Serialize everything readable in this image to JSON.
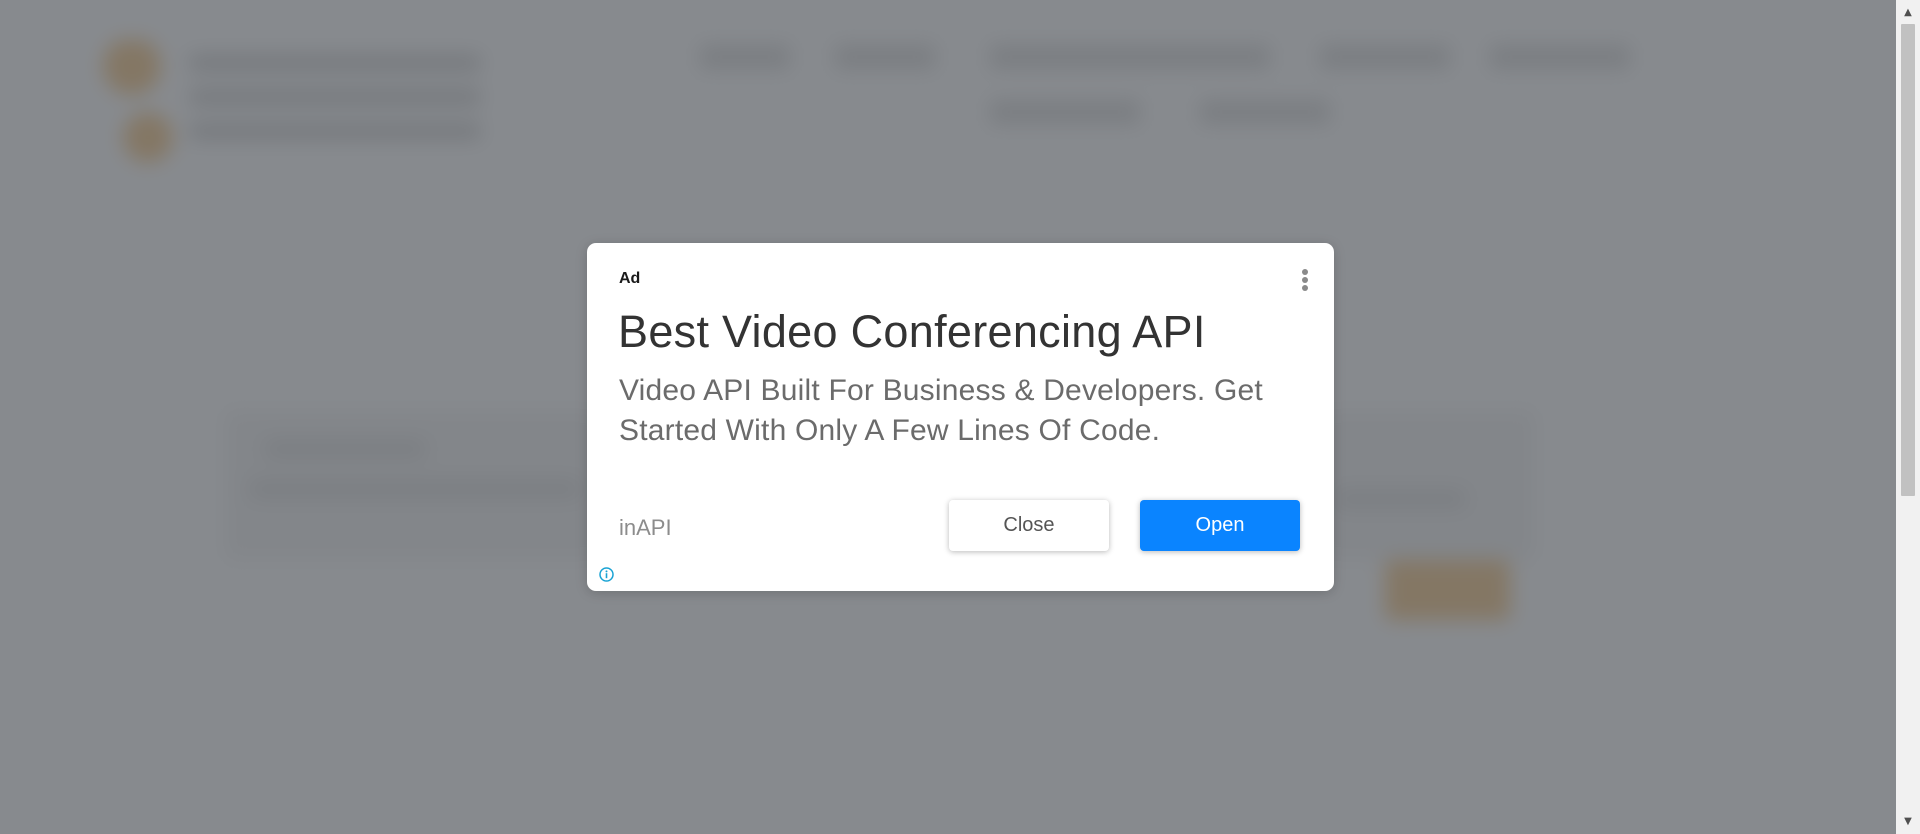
{
  "ad": {
    "label": "Ad",
    "headline": "Best Video Conferencing API",
    "body": "Video API Built For Business & Developers. Get Started With Only A Few Lines Of Code.",
    "advertiser": "inAPI",
    "close_label": "Close",
    "open_label": "Open",
    "menu_icon": "vertical-dots-icon",
    "info_icon": "info-icon"
  },
  "colors": {
    "open_button": "#0a84ff",
    "overlay": "#696d72",
    "info_icon": "#1aa3d4"
  }
}
